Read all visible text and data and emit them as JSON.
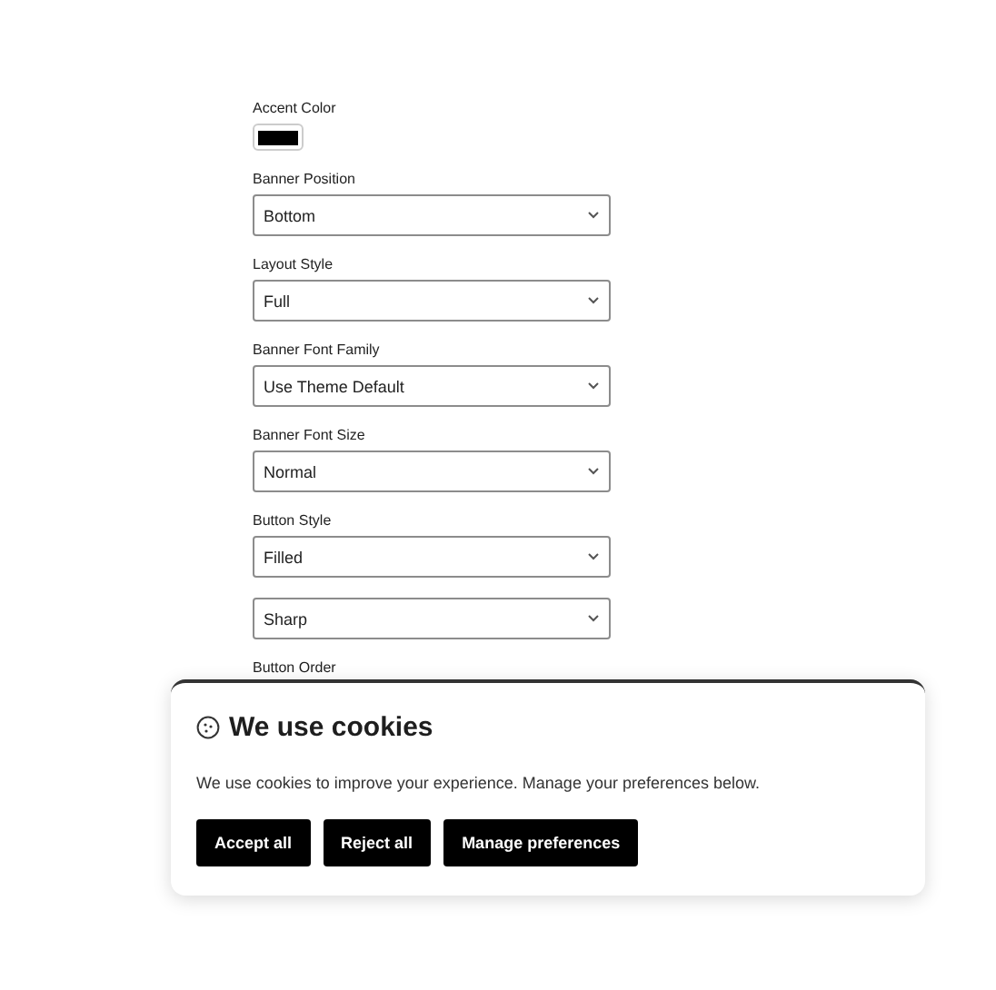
{
  "accent_color": {
    "label": "Accent Color",
    "color": "#000000"
  },
  "fields": [
    {
      "label": "Banner Position",
      "value": "Bottom"
    },
    {
      "label": "Layout Style",
      "value": "Full"
    },
    {
      "label": "Banner Font Family",
      "value": "Use Theme Default"
    },
    {
      "label": "Banner Font Size",
      "value": "Normal"
    },
    {
      "label": "Button Style",
      "value": "Filled"
    },
    {
      "value": "Sharp"
    }
  ],
  "trailing_label": "Button Order",
  "banner": {
    "title": "We use cookies",
    "text": "We use cookies to improve your experience. Manage your preferences below.",
    "buttons": [
      "Accept all",
      "Reject all",
      "Manage preferences"
    ]
  }
}
